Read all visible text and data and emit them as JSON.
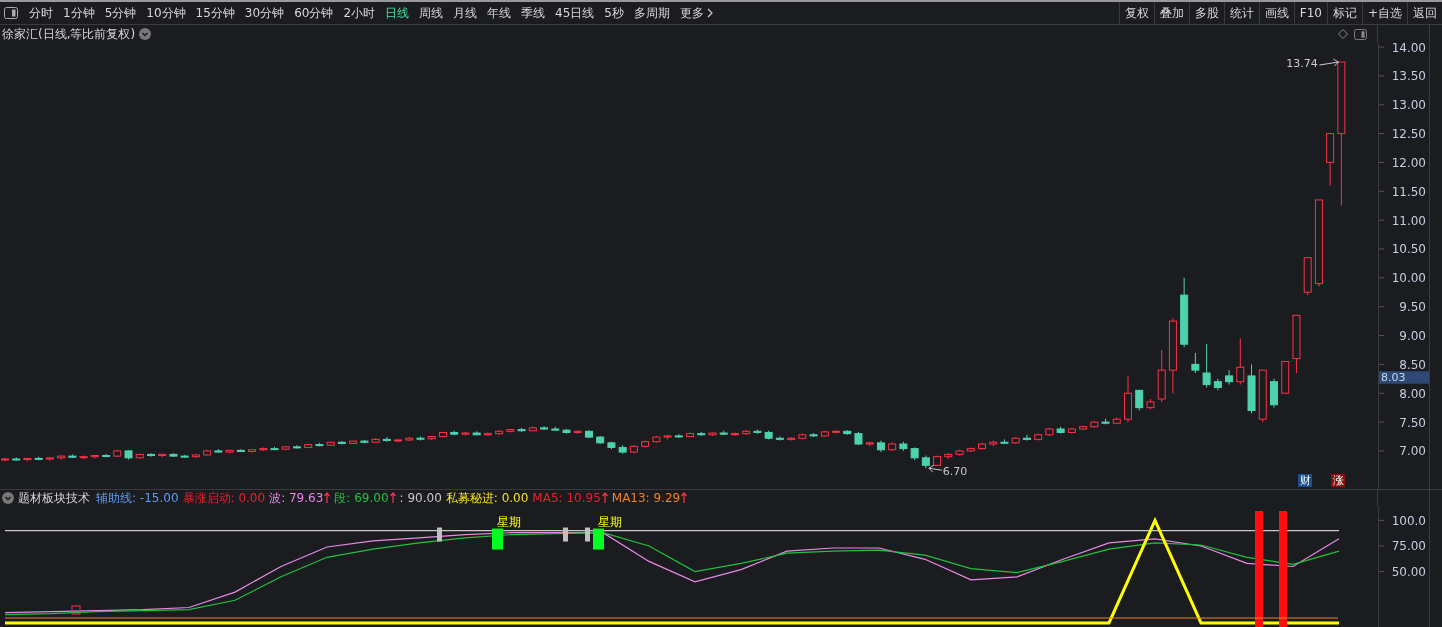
{
  "toolbar": {
    "periods": [
      {
        "label": "分时",
        "selected": false
      },
      {
        "label": "1分钟",
        "selected": false
      },
      {
        "label": "5分钟",
        "selected": false
      },
      {
        "label": "10分钟",
        "selected": false
      },
      {
        "label": "15分钟",
        "selected": false
      },
      {
        "label": "30分钟",
        "selected": false
      },
      {
        "label": "60分钟",
        "selected": false
      },
      {
        "label": "2小时",
        "selected": false
      },
      {
        "label": "日线",
        "selected": true
      },
      {
        "label": "周线",
        "selected": false
      },
      {
        "label": "月线",
        "selected": false
      },
      {
        "label": "年线",
        "selected": false
      },
      {
        "label": "季线",
        "selected": false
      },
      {
        "label": "45日线",
        "selected": false
      },
      {
        "label": "5秒",
        "selected": false
      },
      {
        "label": "多周期",
        "selected": false
      }
    ],
    "more": "更多",
    "actions": [
      "复权",
      "叠加",
      "多股",
      "统计",
      "画线",
      "F10",
      "标记",
      "+自选",
      "返回"
    ]
  },
  "chart_title": "徐家汇(日线,等比前复权)",
  "price_chart": {
    "current": "8.03",
    "high_label": "13.74",
    "low_label": "6.70",
    "chart_data": {
      "type": "candlestick",
      "ylim": [
        6.34,
        14.07
      ],
      "yticks": [
        {
          "value": 14,
          "label": "14.00"
        },
        {
          "value": 13.5,
          "label": "13.50"
        },
        {
          "value": 13,
          "label": "13.00"
        },
        {
          "value": 12.5,
          "label": "12.50"
        },
        {
          "value": 12,
          "label": "12.00"
        },
        {
          "value": 11.5,
          "label": "11.50"
        },
        {
          "value": 11,
          "label": "11.00"
        },
        {
          "value": 10.5,
          "label": "10.50"
        },
        {
          "value": 10,
          "label": "10.00"
        },
        {
          "value": 9.5,
          "label": "9.50"
        },
        {
          "value": 9,
          "label": "9.00"
        },
        {
          "value": 8.5,
          "label": "8.50"
        },
        {
          "value": 8,
          "label": "8.00"
        },
        {
          "value": 7.5,
          "label": "7.50"
        },
        {
          "value": 7,
          "label": "7.00"
        }
      ],
      "ohlc": [
        [
          6.85,
          6.88,
          6.82,
          6.86
        ],
        [
          6.86,
          6.89,
          6.83,
          6.85
        ],
        [
          6.85,
          6.88,
          6.82,
          6.87
        ],
        [
          6.87,
          6.9,
          6.84,
          6.86
        ],
        [
          6.86,
          6.89,
          6.83,
          6.88
        ],
        [
          6.88,
          6.92,
          6.85,
          6.91
        ],
        [
          6.91,
          6.94,
          6.88,
          6.89
        ],
        [
          6.89,
          6.92,
          6.86,
          6.9
        ],
        [
          6.9,
          6.93,
          6.87,
          6.92
        ],
        [
          6.92,
          6.95,
          6.89,
          6.91
        ],
        [
          6.91,
          7.02,
          6.9,
          7.0
        ],
        [
          7.0,
          7.01,
          6.85,
          6.88
        ],
        [
          6.88,
          6.95,
          6.86,
          6.94
        ],
        [
          6.94,
          6.96,
          6.9,
          6.92
        ],
        [
          6.92,
          6.95,
          6.89,
          6.94
        ],
        [
          6.94,
          6.96,
          6.9,
          6.91
        ],
        [
          6.91,
          6.93,
          6.88,
          6.9
        ],
        [
          6.9,
          6.94,
          6.88,
          6.93
        ],
        [
          6.93,
          7.02,
          6.92,
          7.0
        ],
        [
          7.0,
          7.03,
          6.97,
          6.98
        ],
        [
          6.98,
          7.02,
          6.96,
          7.01
        ],
        [
          7.01,
          7.03,
          6.98,
          6.99
        ],
        [
          6.99,
          7.03,
          6.97,
          7.02
        ],
        [
          7.02,
          7.06,
          7.0,
          7.04
        ],
        [
          7.04,
          7.07,
          7.01,
          7.03
        ],
        [
          7.03,
          7.08,
          7.01,
          7.07
        ],
        [
          7.07,
          7.1,
          7.04,
          7.06
        ],
        [
          7.06,
          7.12,
          7.05,
          7.11
        ],
        [
          7.11,
          7.14,
          7.08,
          7.1
        ],
        [
          7.1,
          7.16,
          7.09,
          7.15
        ],
        [
          7.15,
          7.17,
          7.11,
          7.13
        ],
        [
          7.13,
          7.18,
          7.12,
          7.17
        ],
        [
          7.17,
          7.19,
          7.13,
          7.15
        ],
        [
          7.15,
          7.22,
          7.14,
          7.2
        ],
        [
          7.2,
          7.24,
          7.16,
          7.18
        ],
        [
          7.18,
          7.21,
          7.15,
          7.19
        ],
        [
          7.19,
          7.24,
          7.17,
          7.22
        ],
        [
          7.22,
          7.25,
          7.18,
          7.21
        ],
        [
          7.21,
          7.26,
          7.19,
          7.25
        ],
        [
          7.25,
          7.33,
          7.24,
          7.32
        ],
        [
          7.32,
          7.35,
          7.27,
          7.29
        ],
        [
          7.29,
          7.33,
          7.27,
          7.31
        ],
        [
          7.31,
          7.34,
          7.27,
          7.28
        ],
        [
          7.28,
          7.32,
          7.26,
          7.3
        ],
        [
          7.3,
          7.36,
          7.28,
          7.34
        ],
        [
          7.34,
          7.38,
          7.32,
          7.37
        ],
        [
          7.37,
          7.4,
          7.33,
          7.35
        ],
        [
          7.35,
          7.42,
          7.34,
          7.4
        ],
        [
          7.4,
          7.43,
          7.36,
          7.38
        ],
        [
          7.38,
          7.42,
          7.35,
          7.36
        ],
        [
          7.36,
          7.38,
          7.3,
          7.32
        ],
        [
          7.32,
          7.36,
          7.29,
          7.34
        ],
        [
          7.34,
          7.36,
          7.22,
          7.24
        ],
        [
          7.24,
          7.26,
          7.12,
          7.14
        ],
        [
          7.14,
          7.16,
          7.03,
          7.06
        ],
        [
          7.06,
          7.1,
          6.95,
          6.98
        ],
        [
          6.98,
          7.1,
          6.96,
          7.08
        ],
        [
          7.08,
          7.18,
          7.06,
          7.16
        ],
        [
          7.16,
          7.26,
          7.14,
          7.24
        ],
        [
          7.24,
          7.28,
          7.2,
          7.26
        ],
        [
          7.26,
          7.29,
          7.23,
          7.25
        ],
        [
          7.25,
          7.32,
          7.24,
          7.3
        ],
        [
          7.3,
          7.33,
          7.26,
          7.28
        ],
        [
          7.28,
          7.32,
          7.26,
          7.31
        ],
        [
          7.31,
          7.35,
          7.28,
          7.29
        ],
        [
          7.29,
          7.32,
          7.26,
          7.3
        ],
        [
          7.3,
          7.36,
          7.28,
          7.34
        ],
        [
          7.34,
          7.37,
          7.3,
          7.32
        ],
        [
          7.32,
          7.35,
          7.2,
          7.22
        ],
        [
          7.22,
          7.25,
          7.18,
          7.2
        ],
        [
          7.2,
          7.24,
          7.18,
          7.22
        ],
        [
          7.22,
          7.3,
          7.2,
          7.28
        ],
        [
          7.28,
          7.31,
          7.24,
          7.26
        ],
        [
          7.26,
          7.35,
          7.25,
          7.33
        ],
        [
          7.33,
          7.36,
          7.3,
          7.34
        ],
        [
          7.34,
          7.36,
          7.28,
          7.3
        ],
        [
          7.3,
          7.33,
          7.1,
          7.12
        ],
        [
          7.12,
          7.16,
          7.08,
          7.14
        ],
        [
          7.14,
          7.18,
          6.98,
          7.02
        ],
        [
          7.02,
          7.15,
          7.0,
          7.12
        ],
        [
          7.12,
          7.16,
          7.0,
          7.04
        ],
        [
          7.04,
          7.06,
          6.84,
          6.88
        ],
        [
          6.88,
          6.92,
          6.7,
          6.75
        ],
        [
          6.75,
          6.92,
          6.74,
          6.9
        ],
        [
          6.9,
          6.96,
          6.86,
          6.94
        ],
        [
          6.94,
          7.02,
          6.92,
          7.0
        ],
        [
          7.0,
          7.06,
          6.98,
          7.04
        ],
        [
          7.04,
          7.14,
          7.02,
          7.12
        ],
        [
          7.12,
          7.18,
          7.08,
          7.15
        ],
        [
          7.15,
          7.2,
          7.12,
          7.14
        ],
        [
          7.14,
          7.24,
          7.12,
          7.22
        ],
        [
          7.22,
          7.28,
          7.18,
          7.2
        ],
        [
          7.2,
          7.3,
          7.18,
          7.28
        ],
        [
          7.28,
          7.4,
          7.26,
          7.38
        ],
        [
          7.38,
          7.42,
          7.3,
          7.32
        ],
        [
          7.32,
          7.4,
          7.3,
          7.38
        ],
        [
          7.38,
          7.44,
          7.36,
          7.42
        ],
        [
          7.42,
          7.52,
          7.4,
          7.5
        ],
        [
          7.5,
          7.56,
          7.46,
          7.48
        ],
        [
          7.48,
          7.58,
          7.46,
          7.55
        ],
        [
          7.55,
          8.3,
          7.5,
          8.0
        ],
        [
          8.05,
          8.05,
          7.7,
          7.75
        ],
        [
          7.75,
          7.9,
          7.72,
          7.85
        ],
        [
          7.9,
          8.75,
          7.85,
          8.4
        ],
        [
          8.4,
          9.3,
          8.0,
          9.25
        ],
        [
          9.7,
          10.0,
          8.8,
          8.85
        ],
        [
          8.5,
          8.7,
          8.35,
          8.4
        ],
        [
          8.35,
          8.85,
          8.1,
          8.15
        ],
        [
          8.2,
          8.25,
          8.05,
          8.1
        ],
        [
          8.3,
          8.4,
          8.15,
          8.2
        ],
        [
          8.2,
          8.95,
          8.15,
          8.45
        ],
        [
          8.3,
          8.5,
          7.65,
          7.7
        ],
        [
          7.55,
          8.4,
          7.5,
          8.4
        ],
        [
          8.2,
          8.25,
          7.75,
          7.8
        ],
        [
          8.0,
          8.55,
          8.0,
          8.55
        ],
        [
          8.6,
          9.35,
          8.35,
          9.35
        ],
        [
          9.75,
          10.35,
          9.7,
          10.35
        ],
        [
          9.9,
          11.35,
          9.85,
          11.35
        ],
        [
          12.0,
          12.5,
          11.6,
          12.5
        ],
        [
          12.5,
          13.74,
          11.25,
          13.74
        ]
      ]
    }
  },
  "badges": [
    {
      "text": "财",
      "color": "#1d4f8a"
    },
    {
      "text": "涨",
      "color": "#8a1010"
    }
  ],
  "indicator": {
    "name": "题材板块技术",
    "legend": [
      {
        "label": "辅助线:",
        "value": "-15.00",
        "color": "#5b9cf0",
        "rising": false
      },
      {
        "label": "暴涨启动:",
        "value": "0.00",
        "color": "#e8202a",
        "rising": false
      },
      {
        "label": "波:",
        "value": "79.63",
        "color": "#e888e8",
        "rising": true
      },
      {
        "label": "段:",
        "value": "69.00",
        "color": "#1fc23a",
        "rising": true
      },
      {
        "label": ":",
        "value": "90.00",
        "color": "#c8c8c8",
        "rising": false
      },
      {
        "label": "私募秘进:",
        "value": "0.00",
        "color": "#f0e020",
        "rising": false
      },
      {
        "label": "MA5:",
        "value": "10.95",
        "color": "#e8202a",
        "rising": true
      },
      {
        "label": "MA13:",
        "value": "9.29",
        "color": "#f08020",
        "rising": true
      }
    ],
    "signals": [
      "星期",
      "星期"
    ],
    "chart_data": {
      "type": "line",
      "ylim": [
        -4,
        114
      ],
      "yticks": [
        {
          "value": 100,
          "label": "100.0"
        },
        {
          "value": 75,
          "label": "75.00"
        },
        {
          "value": 50,
          "label": "50.00"
        }
      ],
      "series": [
        {
          "color": "#e888e8",
          "values": [
            10,
            11,
            12,
            13,
            15,
            30,
            55,
            74,
            80,
            83,
            86,
            88,
            88,
            88,
            60,
            40,
            52,
            70,
            73,
            73,
            62,
            42,
            45,
            62,
            78,
            82,
            75,
            58,
            55,
            82
          ]
        },
        {
          "color": "#1fc23a",
          "values": [
            8,
            9,
            11,
            12,
            13,
            22,
            45,
            64,
            72,
            78,
            83,
            86,
            87,
            88,
            75,
            50,
            58,
            68,
            70,
            71,
            66,
            53,
            49,
            60,
            72,
            78,
            76,
            64,
            57,
            70
          ]
        },
        {
          "color": "#c8c8c8",
          "values": [
            90,
            90,
            90,
            90,
            90,
            90,
            90,
            90,
            90,
            90,
            90,
            90,
            90,
            90,
            90,
            90,
            90,
            90,
            90,
            90,
            90,
            90,
            90,
            90,
            90,
            90,
            90,
            90,
            90,
            90
          ]
        },
        {
          "color": "#ffff00",
          "values": [
            0,
            0,
            0,
            0,
            0,
            0,
            0,
            0,
            0,
            0,
            0,
            0,
            0,
            0,
            0,
            0,
            0,
            0,
            0,
            0,
            0,
            0,
            0,
            0,
            0,
            100,
            0,
            0,
            0,
            0
          ]
        }
      ]
    }
  }
}
